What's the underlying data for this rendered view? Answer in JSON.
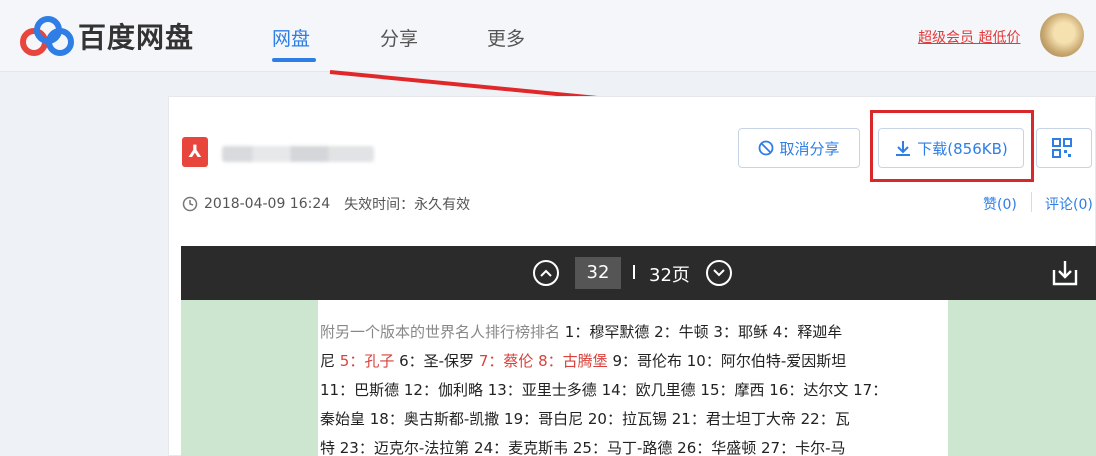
{
  "header": {
    "logo_text": "百度网盘",
    "tabs": [
      {
        "label": "网盘",
        "active": true
      },
      {
        "label": "分享",
        "active": false
      },
      {
        "label": "更多",
        "active": false
      }
    ],
    "promo": "超级会员 超低价"
  },
  "share": {
    "file_icon": "pdf-icon",
    "cancel_share_label": "取消分享",
    "download_label": "下载(856KB)",
    "qr_icon": "qrcode-icon",
    "created": "2018-04-09 16:24",
    "expire": "失效时间：永久有效",
    "like": "赞(0)",
    "comment": "评论(0)"
  },
  "viewer": {
    "current_page": "32",
    "total_pages": "32页"
  },
  "document": {
    "lines": [
      [
        {
          "t": "附另一个版本的世界名人排行榜排名 ",
          "c": "gray"
        },
        {
          "t": "1：穆罕默德  2：牛顿 3：耶稣 4：释迦牟",
          "c": ""
        }
      ],
      [
        {
          "t": "尼 ",
          "c": ""
        },
        {
          "t": "5：孔子",
          "c": "red"
        },
        {
          "t": " 6：圣-保罗 ",
          "c": ""
        },
        {
          "t": "7：蔡伦 8：古腾堡",
          "c": "red"
        },
        {
          "t": " 9：哥伦布 10：阿尔伯特-爱因斯坦",
          "c": ""
        }
      ],
      [
        {
          "t": "11：巴斯德 12：伽利略 13：亚里士多德 14：欧几里德 15：摩西 16：达尔文 17：",
          "c": ""
        }
      ],
      [
        {
          "t": "秦始皇 18：奥古斯都-凯撒 19：哥白尼 20：拉瓦锡 21：君士坦丁大帝 22：瓦",
          "c": ""
        }
      ],
      [
        {
          "t": "特 23：迈克尔-法拉第 24：麦克斯韦 25：马丁-路德 26：华盛顿 27：卡尔-马",
          "c": ""
        }
      ]
    ]
  },
  "colors": {
    "accent": "#2e7ee6",
    "highlight": "#d8282a",
    "promo": "#e23a3a"
  }
}
